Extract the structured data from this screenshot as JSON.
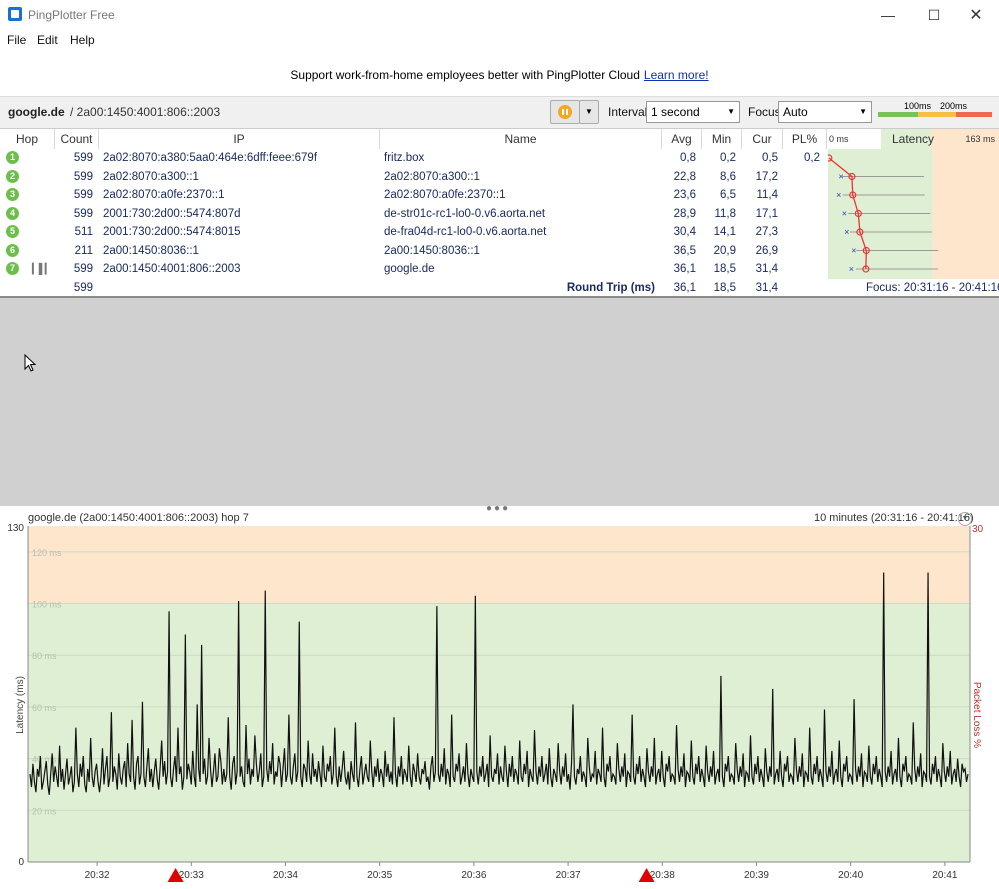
{
  "window": {
    "title": "PingPlotter Free"
  },
  "menu": [
    "File",
    "Edit",
    "Help"
  ],
  "promo": {
    "text": "Support work-from-home employees better with PingPlotter Cloud",
    "link": "Learn more!"
  },
  "toolbar": {
    "host": "google.de",
    "ip": "/ 2a00:1450:4001:806::2003",
    "interval_label": "Interval",
    "interval_value": "1 second",
    "focus_label": "Focus",
    "focus_value": "Auto",
    "scale_100": "100ms",
    "scale_200": "200ms"
  },
  "table": {
    "headers": {
      "hop": "Hop",
      "count": "Count",
      "ip": "IP",
      "name": "Name",
      "avg": "Avg",
      "min": "Min",
      "cur": "Cur",
      "pl": "PL%",
      "latency_min": "0 ms",
      "latency": "Latency",
      "latency_max": "163 ms"
    },
    "rows": [
      {
        "hop": "1",
        "count": "599",
        "ip": "2a02:8070:a380:5aa0:464e:6dff:feee:679f",
        "name": "fritz.box",
        "avg": "0,8",
        "min": "0,2",
        "cur": "0,5",
        "pl": "0,2"
      },
      {
        "hop": "2",
        "count": "599",
        "ip": "2a02:8070:a300::1",
        "name": "2a02:8070:a300::1",
        "avg": "22,8",
        "min": "8,6",
        "cur": "17,2",
        "pl": ""
      },
      {
        "hop": "3",
        "count": "599",
        "ip": "2a02:8070:a0fe:2370::1",
        "name": "2a02:8070:a0fe:2370::1",
        "avg": "23,6",
        "min": "6,5",
        "cur": "11,4",
        "pl": ""
      },
      {
        "hop": "4",
        "count": "599",
        "ip": "2001:730:2d00::5474:807d",
        "name": "de-str01c-rc1-lo0-0.v6.aorta.net",
        "avg": "28,9",
        "min": "11,8",
        "cur": "17,1",
        "pl": ""
      },
      {
        "hop": "5",
        "count": "511",
        "ip": "2001:730:2d00::5474:8015",
        "name": "de-fra04d-rc1-lo0-0.v6.aorta.net",
        "avg": "30,4",
        "min": "14,1",
        "cur": "27,3",
        "pl": ""
      },
      {
        "hop": "6",
        "count": "211",
        "ip": "2a00:1450:8036::1",
        "name": "2a00:1450:8036::1",
        "avg": "36,5",
        "min": "20,9",
        "cur": "26,9",
        "pl": ""
      },
      {
        "hop": "7",
        "count": "599",
        "ip": "2a00:1450:4001:806::2003",
        "name": "google.de",
        "avg": "36,1",
        "min": "18,5",
        "cur": "31,4",
        "pl": ""
      }
    ],
    "summary": {
      "count": "599",
      "label": "Round Trip (ms)",
      "avg": "36,1",
      "min": "18,5",
      "cur": "31,4",
      "focus": "Focus: 20:31:16 - 20:41:16"
    },
    "latency_hops_ms": [
      0.8,
      22.8,
      23.6,
      28.9,
      30.4,
      36.5,
      36.1
    ],
    "latency_scale_max_ms": 163
  },
  "graph": {
    "title": "google.de (2a00:1450:4001:806::2003) hop 7",
    "range": "10 minutes (20:31:16 - 20:41:16)",
    "y_left_label": "Latency (ms)",
    "y_right_label": "Packet Loss %",
    "y_max_label": "130",
    "y_min_label": "0",
    "y_right_max_label": "30",
    "gridlines": [
      "120 ms",
      "100 ms",
      "80 ms",
      "60 ms",
      "40 ms",
      "20 ms"
    ],
    "times": [
      "20:32",
      "20:33",
      "20:34",
      "20:35",
      "20:36",
      "20:37",
      "20:38",
      "20:39",
      "20:40",
      "20:41"
    ]
  },
  "chart_data": {
    "type": "line",
    "title": "google.de (2a00:1450:4001:806::2003) hop 7",
    "xlabel": "",
    "ylabel": "Latency (ms)",
    "ylim": [
      0,
      130
    ],
    "x_start": "20:31:16",
    "x_end": "20:41:16",
    "zones": [
      {
        "from": 0,
        "to": 100,
        "color": "#deefd4"
      },
      {
        "from": 100,
        "to": 130,
        "color": "#fde6cc"
      }
    ],
    "packet_loss_markers_at": [
      "20:32:50",
      "20:37:50"
    ],
    "series": [
      {
        "values": [
          34,
          29,
          38,
          31,
          27,
          36,
          33,
          41,
          28,
          31,
          35,
          39,
          30,
          26,
          34,
          42,
          31,
          37,
          33,
          29,
          45,
          31,
          36,
          28,
          34,
          40,
          30,
          33,
          37,
          27,
          31,
          52,
          34,
          29,
          38,
          33,
          41,
          30,
          27,
          36,
          31,
          48,
          33,
          29,
          35,
          38,
          31,
          27,
          33,
          44,
          30,
          36,
          41,
          29,
          33,
          58,
          31,
          37,
          34,
          28,
          42,
          33,
          30,
          36,
          39,
          29,
          46,
          34,
          31,
          55,
          33,
          28,
          38,
          41,
          30,
          34,
          62,
          33,
          29,
          37,
          44,
          31,
          36,
          29,
          35,
          40,
          32,
          28,
          37,
          47,
          33,
          39,
          30,
          35,
          97,
          33,
          29,
          36,
          41,
          31,
          52,
          34,
          37,
          28,
          33,
          88,
          32,
          38,
          35,
          30,
          43,
          33,
          29,
          61,
          36,
          31,
          84,
          34,
          40,
          30,
          33,
          48,
          36,
          29,
          35,
          42,
          31,
          33,
          44,
          39,
          30,
          36,
          31,
          34,
          56,
          33,
          28,
          38,
          41,
          30,
          35,
          101,
          33,
          37,
          31,
          29,
          53,
          34,
          40,
          30,
          36,
          33,
          49,
          38,
          31,
          35,
          42,
          29,
          33,
          105,
          36,
          31,
          39,
          34,
          46,
          30,
          35,
          33,
          41,
          38,
          29,
          36,
          44,
          31,
          34,
          57,
          33,
          30,
          37,
          42,
          31,
          35,
          93,
          33,
          29,
          38,
          36,
          31,
          47,
          34,
          30,
          42,
          33,
          36,
          31,
          39,
          34,
          29,
          45,
          33,
          31,
          38,
          35,
          41,
          30,
          34,
          52,
          33,
          29,
          37,
          31,
          36,
          43,
          33,
          30,
          35,
          28,
          39,
          34,
          31,
          54,
          33,
          29,
          36,
          41,
          30,
          34,
          38,
          33,
          31,
          47,
          35,
          29,
          37,
          33,
          40,
          31,
          36,
          34,
          29,
          43,
          33,
          38,
          31,
          35,
          30,
          56,
          34,
          29,
          37,
          33,
          41,
          30,
          36,
          34,
          31,
          45,
          33,
          29,
          38,
          35,
          31,
          42,
          33,
          30,
          36,
          34,
          39,
          31,
          33,
          28,
          37,
          41,
          31,
          35,
          99,
          34,
          31,
          38,
          33,
          44,
          30,
          36,
          34,
          29,
          57,
          33,
          31,
          38,
          35,
          42,
          30,
          33,
          37,
          31,
          46,
          34,
          29,
          36,
          33,
          31,
          103,
          35,
          30,
          37,
          33,
          41,
          31,
          34,
          38,
          29,
          49,
          33,
          31,
          36,
          34,
          42,
          30,
          37,
          33,
          31,
          45,
          35,
          29,
          38,
          33,
          41,
          31,
          36,
          34,
          30,
          47,
          33,
          31,
          38,
          34,
          43,
          29,
          36,
          33,
          31,
          51,
          35,
          30,
          37,
          33,
          41,
          31,
          34,
          38,
          30,
          44,
          33,
          29,
          36,
          34,
          31,
          46,
          35,
          30,
          37,
          33,
          42,
          31,
          34,
          28,
          38,
          61,
          33,
          30,
          36,
          34,
          41,
          31,
          35,
          33,
          29,
          48,
          37,
          31,
          34,
          33,
          43,
          30,
          36,
          34,
          31,
          52,
          33,
          29,
          38,
          35,
          41,
          31,
          34,
          33,
          30,
          46,
          36,
          31,
          37,
          33,
          42,
          29,
          35,
          34,
          31,
          57,
          33,
          30,
          38,
          34,
          41,
          31,
          36,
          33,
          29,
          44,
          35,
          31,
          37,
          33,
          48,
          30,
          34,
          36,
          31,
          43,
          33,
          29,
          38,
          35,
          41,
          31,
          34,
          33,
          30,
          53,
          36,
          31,
          37,
          33,
          42,
          29,
          35,
          34,
          31,
          47,
          33,
          30,
          38,
          34,
          41,
          31,
          36,
          33,
          29,
          45,
          35,
          31,
          37,
          33,
          43,
          30,
          34,
          36,
          31,
          72,
          33,
          29,
          38,
          35,
          41,
          31,
          34,
          33,
          30,
          46,
          36,
          31,
          37,
          33,
          42,
          29,
          35,
          34,
          31,
          49,
          33,
          30,
          38,
          34,
          41,
          31,
          36,
          33,
          29,
          44,
          35,
          31,
          37,
          33,
          67,
          30,
          34,
          36,
          31,
          43,
          33,
          29,
          38,
          35,
          41,
          31,
          34,
          33,
          30,
          48,
          36,
          31,
          37,
          33,
          42,
          29,
          35,
          34,
          31,
          52,
          33,
          30,
          38,
          34,
          41,
          31,
          36,
          33,
          29,
          59,
          35,
          31,
          37,
          33,
          43,
          30,
          34,
          36,
          31,
          47,
          33,
          29,
          38,
          35,
          41,
          31,
          34,
          33,
          30,
          63,
          36,
          31,
          37,
          33,
          42,
          29,
          35,
          34,
          31,
          45,
          33,
          30,
          38,
          34,
          41,
          31,
          36,
          33,
          29,
          112,
          35,
          31,
          37,
          33,
          43,
          30,
          34,
          36,
          31,
          48,
          33,
          29,
          38,
          35,
          41,
          31,
          34,
          33,
          30,
          54,
          36,
          31,
          37,
          33,
          42,
          29,
          35,
          34,
          31,
          112,
          33,
          30,
          38,
          34,
          41,
          31,
          36,
          33,
          29,
          46,
          35,
          31,
          37,
          33,
          43,
          30,
          34,
          36,
          31,
          40,
          33,
          29,
          38,
          35,
          36,
          31,
          34
        ]
      }
    ]
  }
}
